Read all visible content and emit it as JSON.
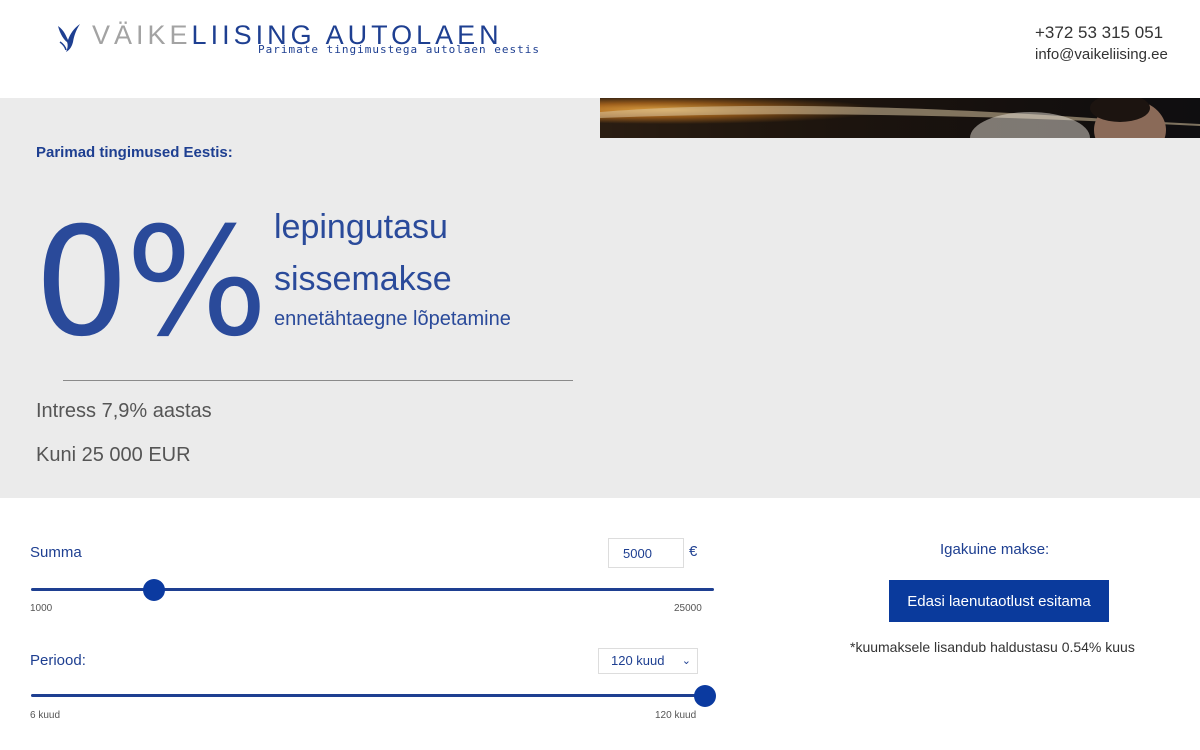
{
  "header": {
    "logo_part1": "VÄIKE",
    "logo_part2": "LIISING AUTOLAEN",
    "tagline": "Parimate tingimustega autolaen eestis",
    "phone": "+372 53 315 051",
    "email": "info@vaikeliising.ee"
  },
  "hero": {
    "lead": "Parimad tingimused Eestis:",
    "percent": "0%",
    "feature_1": "lepingutasu",
    "feature_2": "sissemakse",
    "feature_3": "ennetähtaegne lõpetamine",
    "interest": "Intress 7,9% aastas",
    "max_amount": "Kuni 25 000 EUR"
  },
  "calculator": {
    "amount_label": "Summa",
    "amount_value": "5000",
    "currency": "€",
    "amount_min": "1000",
    "amount_max": "25000",
    "amount_slider_value": 5000,
    "period_label": "Periood:",
    "period_selected": "120 kuud",
    "period_min": "6 kuud",
    "period_max": "120 kuud",
    "period_slider_value": 120,
    "monthly_label": "Igakuine makse:",
    "submit_label": "Edasi laenutaotlust esitama",
    "note": "*kuumaksele lisandub haldustasu 0.54% kuus"
  },
  "colors": {
    "brand_blue": "#1e3f91",
    "button_blue": "#0a3a9c",
    "hero_bg": "#ebebeb"
  },
  "icons": {
    "logo": "bird-logo-icon",
    "select": "chevron-down-icon"
  }
}
